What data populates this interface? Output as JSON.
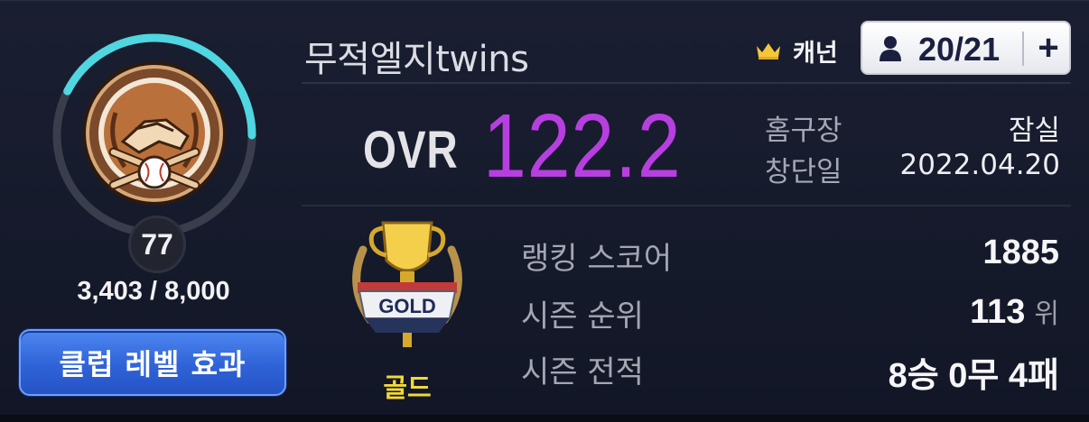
{
  "club": {
    "name": "무적엘지twins",
    "level": "77",
    "xp_text": "3,403 / 8,000",
    "xp_progress": 0.425,
    "effect_button_label": "클럽 레벨 효과"
  },
  "header": {
    "captain_label": "캐넌",
    "member_count": "20/21",
    "add_member_label": "+"
  },
  "overview": {
    "ovr_label": "OVR",
    "ovr_value": "122.2",
    "home_label": "홈구장",
    "home_value": "잠실",
    "founded_label": "창단일",
    "founded_value": "2022.04.20"
  },
  "league": {
    "name": "골드",
    "emblem_text": "GOLD"
  },
  "stats": {
    "ranking_label": "랭킹 스코어",
    "ranking_value": "1885",
    "rank_label": "시즌 순위",
    "rank_value": "113",
    "rank_unit": "위",
    "record_label": "시즌 전적",
    "record_value": "8승 0무 4패"
  },
  "colors": {
    "background": "#14182a",
    "ovr_value": "#b73fe0",
    "xp_ring": "#4fd6e0",
    "league_name": "#f2d83a",
    "button": "#2f63d8"
  },
  "icons": {
    "emblem": "handshake-baseball-emblem-icon",
    "crown": "crown-icon",
    "member": "person-icon",
    "league": "gold-trophy-icon"
  }
}
